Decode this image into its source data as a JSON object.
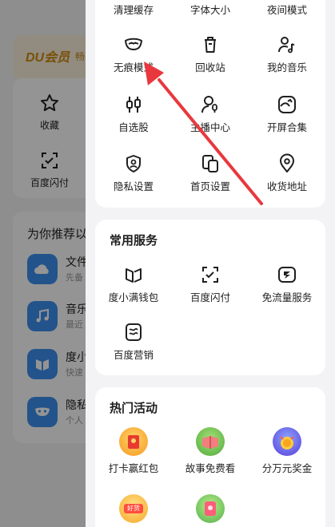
{
  "background": {
    "vip_logo": "DU会员",
    "vip_extra": "畅",
    "tiles": [
      {
        "label": "收藏",
        "icon": "star-icon"
      },
      {
        "label": "百度闪付",
        "icon": "scan-pay-icon"
      }
    ],
    "recommend_title": "为你推荐以",
    "recommend_items": [
      {
        "name": "文件",
        "desc": "先备",
        "icon": "cloud-icon"
      },
      {
        "name": "音乐",
        "desc": "最近",
        "icon": "music-icon"
      },
      {
        "name": "度小",
        "desc": "快速",
        "icon": "wallet-icon"
      },
      {
        "name": "隐私",
        "desc": "个人",
        "icon": "mask-icon"
      }
    ]
  },
  "tools": {
    "top_row": [
      "清理缓存",
      "字体大小",
      "夜间模式"
    ],
    "items": [
      {
        "label": "无痕模式",
        "icon": "incognito-mask-icon"
      },
      {
        "label": "回收站",
        "icon": "trash-icon"
      },
      {
        "label": "我的音乐",
        "icon": "music-note-icon"
      },
      {
        "label": "自选股",
        "icon": "stock-sliders-icon"
      },
      {
        "label": "主播中心",
        "icon": "anchor-mic-icon"
      },
      {
        "label": "开屏合集",
        "icon": "splash-collection-icon"
      },
      {
        "label": "隐私设置",
        "icon": "privacy-shield-icon"
      },
      {
        "label": "首页设置",
        "icon": "homepage-settings-icon"
      },
      {
        "label": "收货地址",
        "icon": "location-pin-icon"
      }
    ]
  },
  "services": {
    "title": "常用服务",
    "items": [
      {
        "label": "度小满钱包",
        "icon": "wallet-icon"
      },
      {
        "label": "百度闪付",
        "icon": "scan-pay-icon"
      },
      {
        "label": "免流量服务",
        "icon": "data-free-icon"
      },
      {
        "label": "百度营销",
        "icon": "marketing-icon"
      }
    ]
  },
  "activities": {
    "title": "热门活动",
    "items": [
      {
        "label": "打卡赢红包",
        "icon": "red-envelope-icon"
      },
      {
        "label": "故事免费看",
        "icon": "story-book-icon"
      },
      {
        "label": "分万元奖金",
        "icon": "bonus-coin-icon"
      },
      {
        "label": "",
        "icon": "goods-badge-icon",
        "badge": "好货"
      },
      {
        "label": "",
        "icon": "gift-icon"
      }
    ]
  },
  "colors": {
    "accent_arrow": "#e8383d",
    "icon_stroke": "#1f1f1f",
    "vip_gold": "#d08a10",
    "rec_blue": "#3d8ff0"
  }
}
